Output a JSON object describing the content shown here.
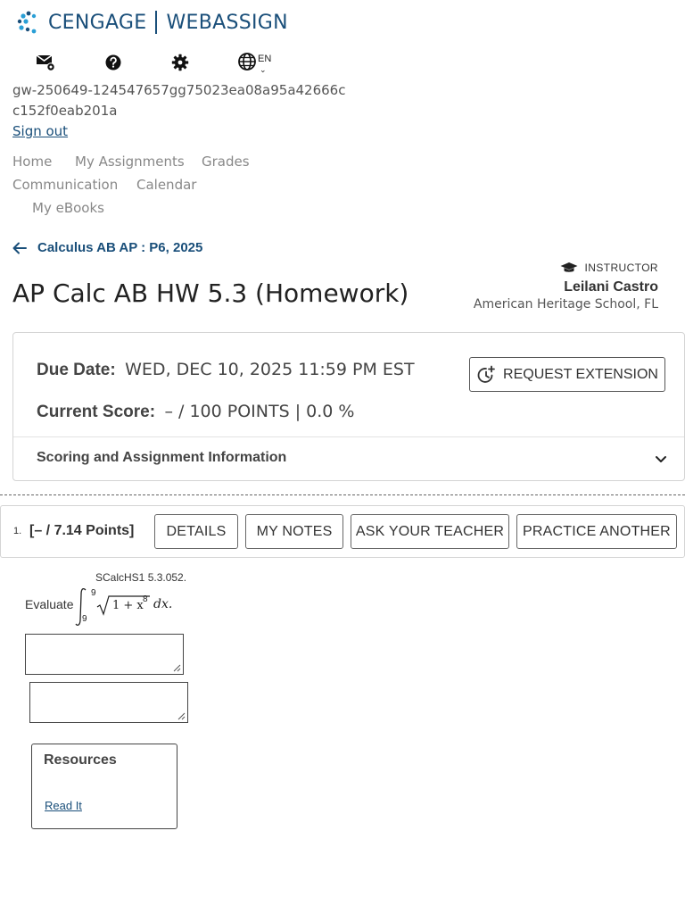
{
  "brand": {
    "name_left": "CENGAGE",
    "name_right": "WEBASSIGN",
    "color": "#1a4f7a"
  },
  "toolbar": {
    "icons": [
      "mail-settings-icon",
      "help-icon",
      "gear-icon",
      "globe-icon"
    ],
    "language": "EN"
  },
  "user": {
    "id": "gw-250649-124547657gg75023ea08a95a42666cc152f0eab201a",
    "signout_label": "Sign out"
  },
  "nav": {
    "home": "Home",
    "my_assignments": "My Assignments",
    "grades": "Grades",
    "communication": "Communication",
    "calendar": "Calendar",
    "my_ebooks": "My eBooks"
  },
  "course": {
    "back_label": "Calculus AB AP : P6, 2025"
  },
  "assignment": {
    "title": "AP Calc AB HW 5.3 (Homework)"
  },
  "instructor": {
    "role": "INSTRUCTOR",
    "name": "Leilani Castro",
    "school": "American Heritage School, FL"
  },
  "summary": {
    "due_label": "Due Date:",
    "due_value": "WED, DEC 10, 2025 11:59 PM EST",
    "score_label": "Current Score:",
    "score_value": "– / 100 POINTS | 0.0 %",
    "request_extension_label": "REQUEST EXTENSION",
    "scoring_info_label": "Scoring and Assignment Information"
  },
  "question": {
    "number": "1.",
    "points": "[– / 7.14 Points]",
    "buttons": {
      "details": "DETAILS",
      "my_notes": "MY NOTES",
      "ask_teacher": "ASK YOUR TEACHER",
      "practice_another": "PRACTICE ANOTHER"
    },
    "code": "SCalcHS1 5.3.052.",
    "evaluate": "Evaluate",
    "integral": {
      "upper": "9",
      "lower": "9",
      "radicand_base": "1 + x",
      "exponent": "8",
      "differential": "dx."
    },
    "answer_1": "",
    "answer_2": ""
  },
  "resources": {
    "title": "Resources",
    "read_it": "Read It"
  }
}
